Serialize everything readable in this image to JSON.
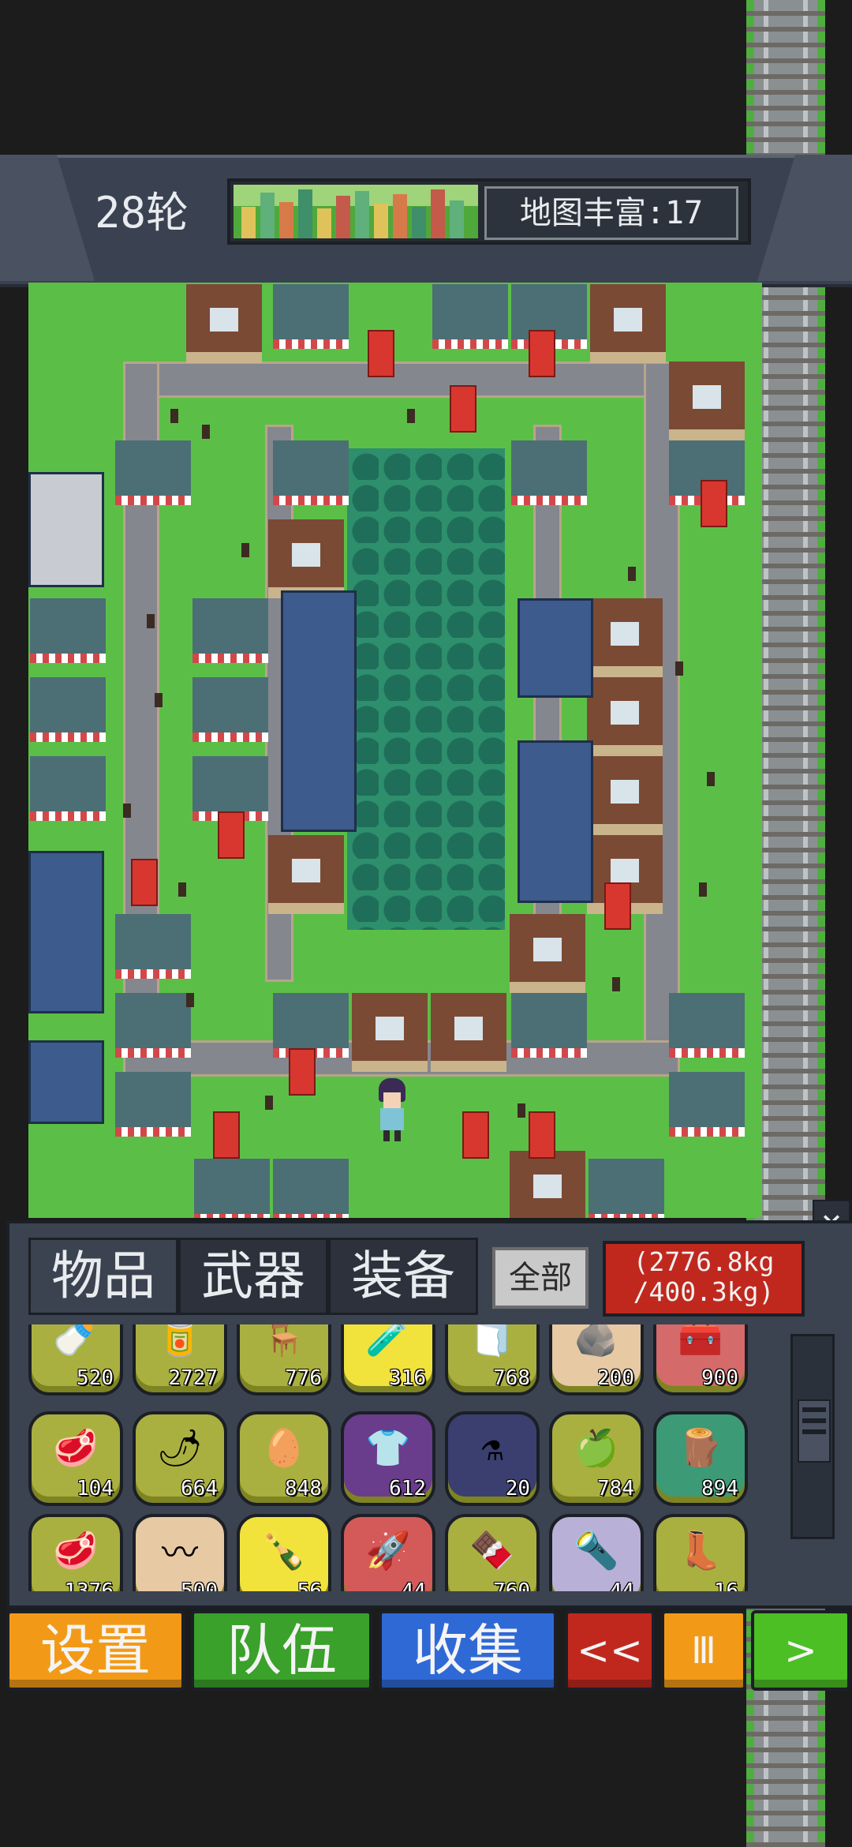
{
  "hud": {
    "round_label": "28轮",
    "map_richness_label": "地图丰富:17"
  },
  "inventory": {
    "tabs": [
      "物品",
      "武器",
      "装备"
    ],
    "filter_label": "全部",
    "weight_current": "(2776.8kg",
    "weight_max": "/400.3kg)",
    "close_symbol": "×",
    "items": [
      {
        "icon": "milk-bottle-icon",
        "glyph": "🍼",
        "count": "520",
        "bg": "#aab040"
      },
      {
        "icon": "canned-food-icon",
        "glyph": "🥫",
        "count": "2727",
        "bg": "#aab040"
      },
      {
        "icon": "chair-icon",
        "glyph": "🪑",
        "count": "776",
        "bg": "#aab040"
      },
      {
        "icon": "potion-icon",
        "glyph": "🧪",
        "count": "316",
        "bg": "#f2e23c"
      },
      {
        "icon": "cloth-icon",
        "glyph": "🧻",
        "count": "768",
        "bg": "#aab040"
      },
      {
        "icon": "stone-icon",
        "glyph": "🪨",
        "count": "200",
        "bg": "#e7c9a4"
      },
      {
        "icon": "medkit-icon",
        "glyph": "🧰",
        "count": "900",
        "bg": "#d46a6a"
      },
      {
        "icon": "meat-can-icon",
        "glyph": "🥩",
        "count": "104",
        "bg": "#aab040"
      },
      {
        "icon": "chili-icon",
        "glyph": "🌶",
        "count": "664",
        "bg": "#aab040"
      },
      {
        "icon": "egg-icon",
        "glyph": "🥚",
        "count": "848",
        "bg": "#aab040"
      },
      {
        "icon": "shirt-icon",
        "glyph": "👕",
        "count": "612",
        "bg": "#6a3c8c"
      },
      {
        "icon": "blueprint-icon",
        "glyph": "⚗",
        "count": "20",
        "bg": "#3a3f70"
      },
      {
        "icon": "apple-icon",
        "glyph": "🍏",
        "count": "784",
        "bg": "#aab040"
      },
      {
        "icon": "wood-log-icon",
        "glyph": "🪵",
        "count": "894",
        "bg": "#3c9a76"
      },
      {
        "icon": "steak-icon",
        "glyph": "🥩",
        "count": "1376",
        "bg": "#aab040"
      },
      {
        "icon": "rope-icon",
        "glyph": "〰",
        "count": "500",
        "bg": "#e7c9a4"
      },
      {
        "icon": "bottle-icon",
        "glyph": "🍾",
        "count": "56",
        "bg": "#f2e23c"
      },
      {
        "icon": "rocket-icon",
        "glyph": "🚀",
        "count": "44",
        "bg": "#d45a5a"
      },
      {
        "icon": "chocolate-icon",
        "glyph": "🍫",
        "count": "760",
        "bg": "#aab040"
      },
      {
        "icon": "baton-icon",
        "glyph": "🔦",
        "count": "44",
        "bg": "#b9b0d8"
      },
      {
        "icon": "boots-icon",
        "glyph": "👢",
        "count": "16",
        "bg": "#aab040"
      }
    ]
  },
  "bottom_bar": {
    "settings_label": "设置",
    "team_label": "队伍",
    "collect_label": "收集",
    "rewind_label": "<<",
    "pause_label": "Ⅲ",
    "play_label": ">"
  },
  "colors": {
    "settings": "#f29a17",
    "team": "#3aa12a",
    "collect": "#2f69d6",
    "rewind": "#c0281e",
    "pause": "#f29a17",
    "play": "#4cbf24"
  }
}
